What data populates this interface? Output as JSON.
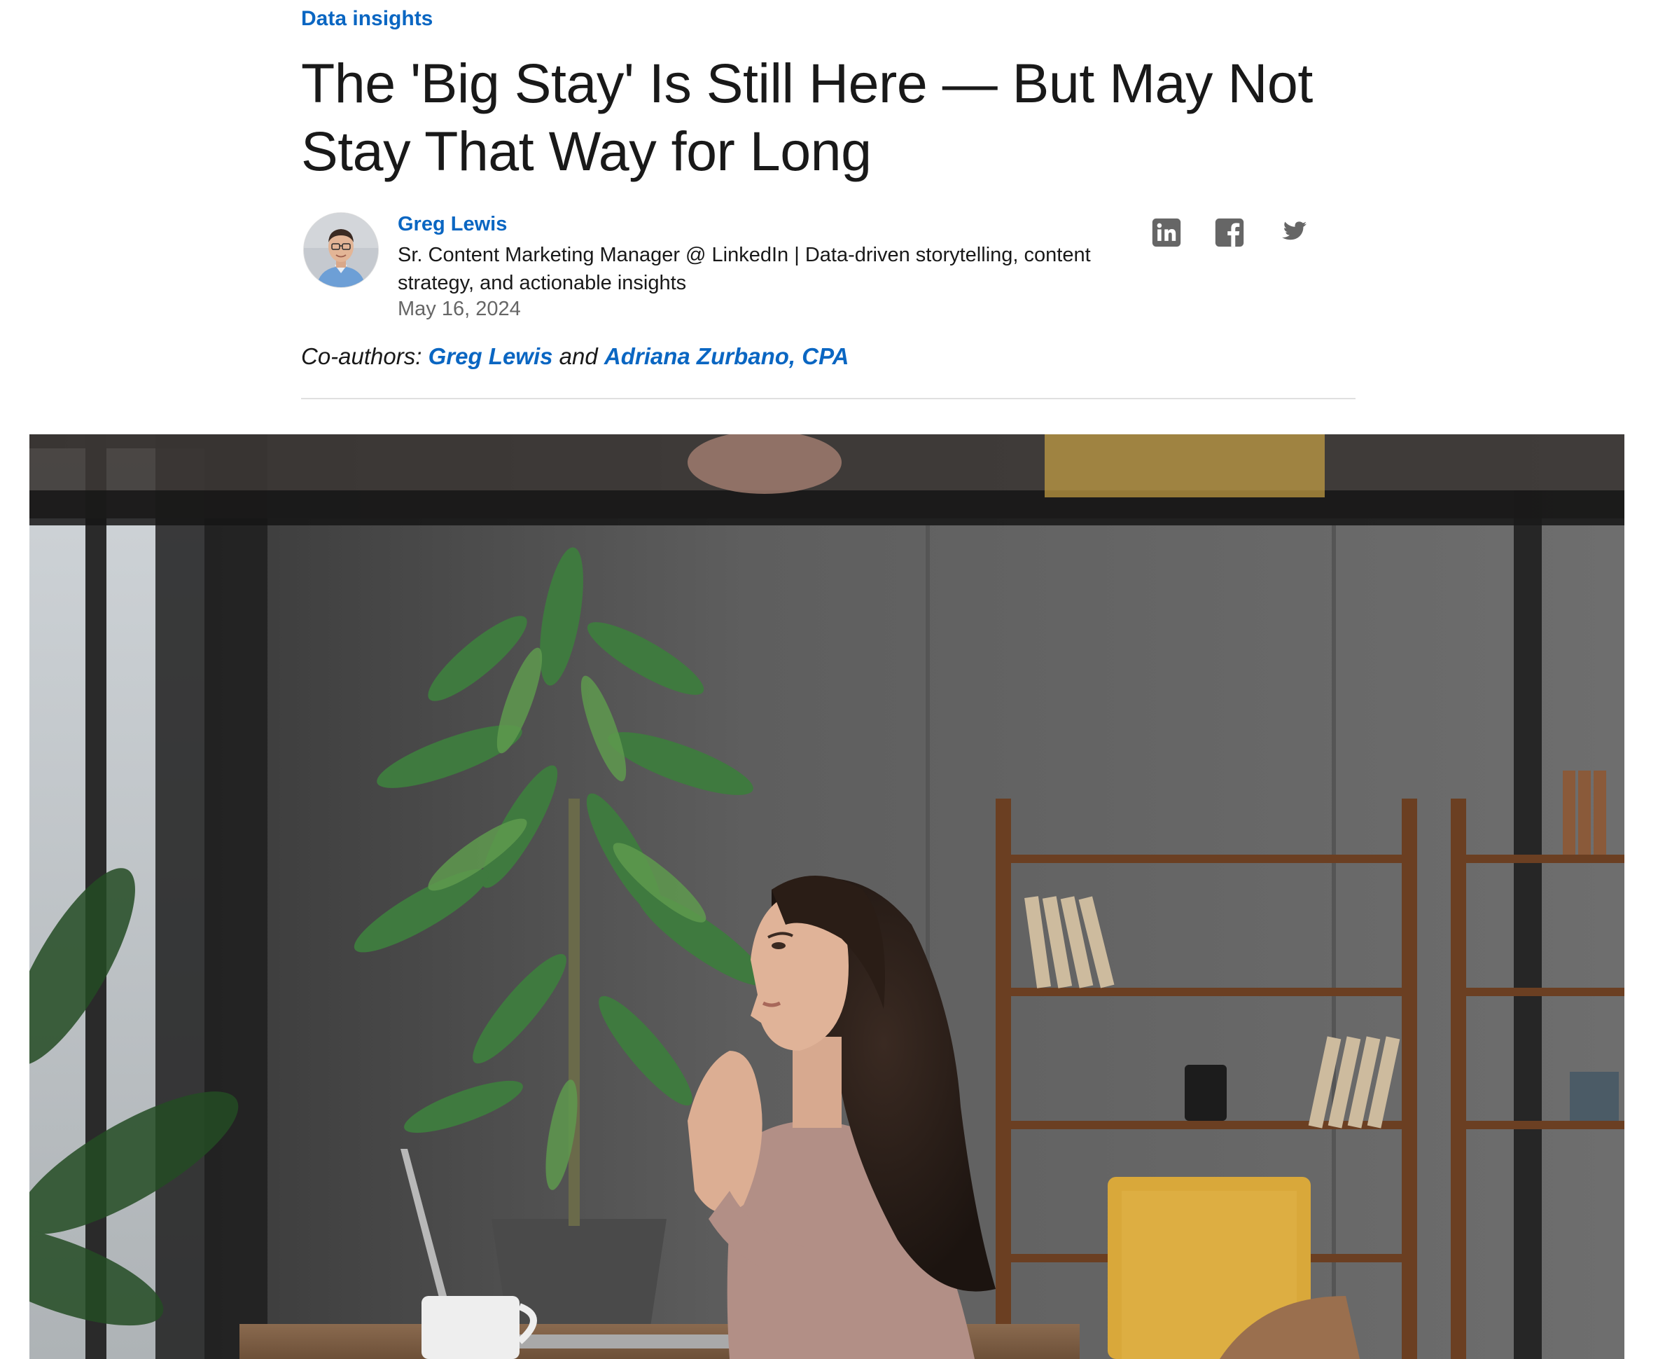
{
  "article": {
    "category": "Data insights",
    "title": "The 'Big Stay' Is Still Here — But May Not Stay That Way for Long",
    "author": {
      "name": "Greg Lewis",
      "headline": "Sr. Content Marketing Manager @ LinkedIn | Data-driven storytelling, content strategy, and actionable insights",
      "date": "May 16, 2024"
    },
    "coauthors": {
      "prefix": "Co-authors:",
      "names": [
        "Greg Lewis",
        "Adriana Zurbano, CPA"
      ],
      "conjunction": "and"
    },
    "share": [
      {
        "network": "LinkedIn",
        "icon": "linkedin-icon"
      },
      {
        "network": "Facebook",
        "icon": "facebook-icon"
      },
      {
        "network": "Twitter",
        "icon": "twitter-icon"
      }
    ]
  },
  "colors": {
    "link_blue": "#0a66c2",
    "text": "#191919",
    "muted": "#666666",
    "icon_gray": "#666666",
    "divider": "#e0e0e0"
  }
}
